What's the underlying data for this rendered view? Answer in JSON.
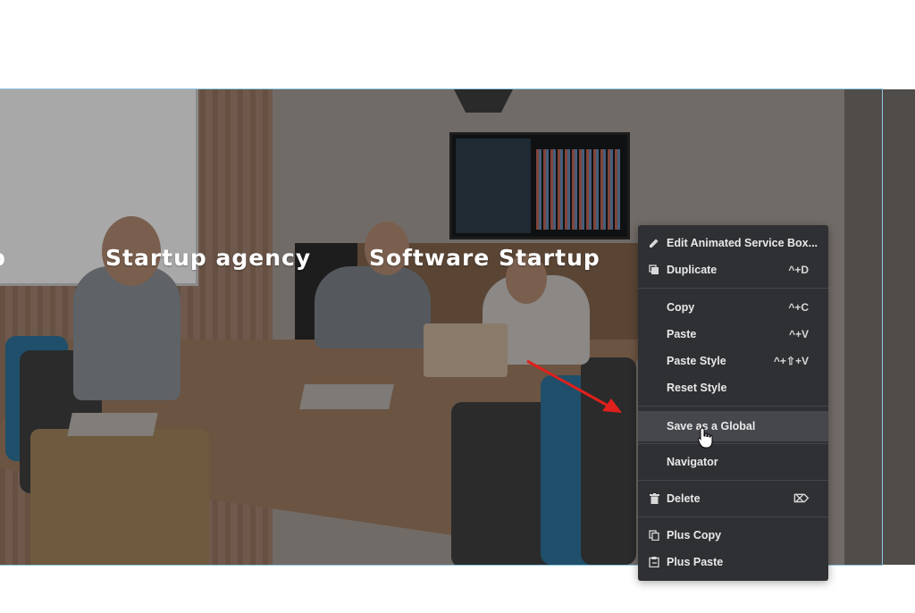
{
  "hero": {
    "partial_label": "p",
    "label_1": "Startup agency",
    "label_2": "Software Startup"
  },
  "context_menu": {
    "items": [
      {
        "label": "Edit Animated Service Box...",
        "shortcut": "",
        "icon": "pencil-icon"
      },
      {
        "label": "Duplicate",
        "shortcut": "^+D",
        "icon": "duplicate-icon"
      },
      {
        "label": "Copy",
        "shortcut": "^+C",
        "icon": ""
      },
      {
        "label": "Paste",
        "shortcut": "^+V",
        "icon": ""
      },
      {
        "label": "Paste Style",
        "shortcut": "^+⇧+V",
        "icon": ""
      },
      {
        "label": "Reset Style",
        "shortcut": "",
        "icon": ""
      },
      {
        "label": "Save as a Global",
        "shortcut": "",
        "icon": ""
      },
      {
        "label": "Navigator",
        "shortcut": "",
        "icon": ""
      },
      {
        "label": "Delete",
        "shortcut": "⌦",
        "icon": "trash-icon"
      },
      {
        "label": "Plus Copy",
        "shortcut": "",
        "icon": "copy-icon"
      },
      {
        "label": "Plus Paste",
        "shortcut": "",
        "icon": "paste-icon"
      }
    ]
  },
  "colors": {
    "menu_bg": "#2f3033",
    "menu_hover": "#45474c",
    "arrow": "#e0201c",
    "section_outline": "#8fc7df"
  }
}
